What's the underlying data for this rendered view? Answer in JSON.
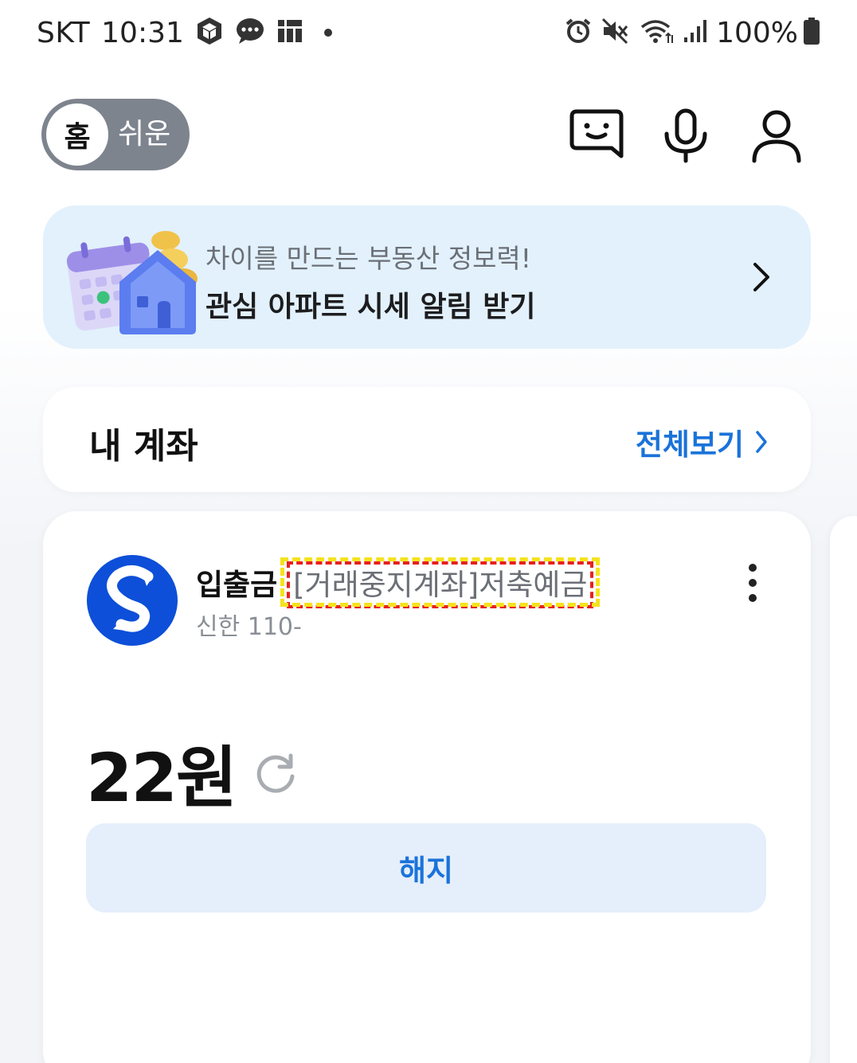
{
  "status_bar": {
    "carrier": "SKT",
    "time": "10:31",
    "battery": "100%",
    "icons_left": [
      "cube-icon",
      "chat-bubble-icon",
      "grid-app-icon"
    ],
    "icons_right": [
      "alarm-icon",
      "mute-icon",
      "wifi-icon",
      "signal-icon",
      "battery-icon"
    ]
  },
  "header": {
    "mode_active": "홈",
    "mode_other": "쉬운",
    "icons": [
      "chatbot-icon",
      "microphone-icon",
      "profile-icon"
    ]
  },
  "banner": {
    "subtitle": "차이를 만드는 부동산 정보력!",
    "title": "관심 아파트 시세 알림 받기"
  },
  "my_accounts": {
    "title": "내 계좌",
    "view_all": "전체보기"
  },
  "account": {
    "type": "입출금",
    "label": "[거래중지계좌]저축예금",
    "number": "신한 110-",
    "balance": "22원",
    "close_button": "해지"
  },
  "colors": {
    "accent_blue": "#1a73d9",
    "banner_bg": "#e2f1fc",
    "button_bg": "#e5eefb",
    "toggle_bg": "#7e848e",
    "bank_blue": "#0d4fd8"
  }
}
